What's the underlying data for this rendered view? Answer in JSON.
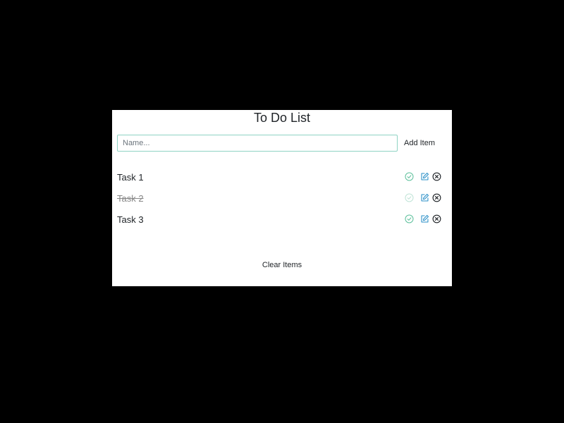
{
  "app": {
    "title": "To Do List"
  },
  "form": {
    "placeholder": "Name...",
    "value": "",
    "add_label": "Add Item"
  },
  "items": [
    {
      "label": "Task 1",
      "done": false
    },
    {
      "label": "Task 2",
      "done": true
    },
    {
      "label": "Task 3",
      "done": false
    }
  ],
  "footer": {
    "clear_label": "Clear Items"
  },
  "icons": {
    "complete": "check-circle-icon",
    "edit": "edit-icon",
    "delete": "x-circle-icon"
  },
  "colors": {
    "page_background": "#000000",
    "card_background": "#ffffff",
    "input_border": "#8fd3c4",
    "check_active": "#5bbf9a",
    "check_done": "#bfe3d6",
    "edit": "#2a8fc7",
    "delete": "#212529",
    "done_text": "#888888"
  }
}
